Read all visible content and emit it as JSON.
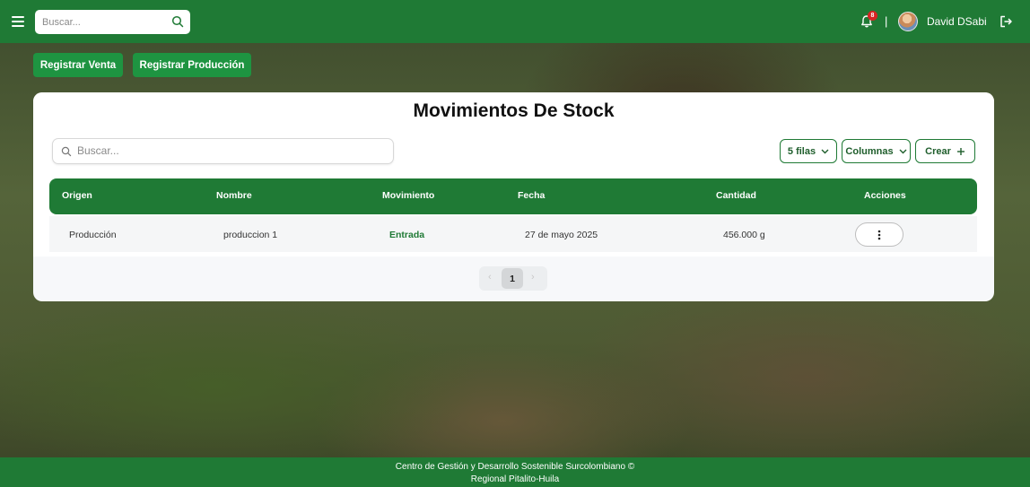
{
  "header": {
    "search_placeholder": "Buscar...",
    "notification_count": "8",
    "separator": "|",
    "user_name": "David DSabi"
  },
  "actions": {
    "register_sale": "Registrar Venta",
    "register_production": "Registrar Producción"
  },
  "card": {
    "title": "Movimientos De Stock",
    "search_placeholder": "Buscar...",
    "rows_label": "5 filas",
    "columns_label": "Columnas",
    "create_label": "Crear"
  },
  "table": {
    "columns": [
      "Origen",
      "Nombre",
      "Movimiento",
      "Fecha",
      "Cantidad",
      "Acciones"
    ],
    "rows": [
      {
        "origen": "Producción",
        "nombre": "produccion 1",
        "movimiento": "Entrada",
        "fecha": "27 de mayo 2025",
        "cantidad": "456.000 g"
      }
    ]
  },
  "pagination": {
    "prev": "‹",
    "current": "1",
    "next": "›"
  },
  "footer": {
    "line1": "Centro de Gestión y Desarrollo Sostenible Surcolombiano ©",
    "line2": "Regional Pitalito-Huila"
  },
  "colors": {
    "primary": "#1f7a35",
    "button_green": "#1e9441",
    "badge_red": "#d62424"
  }
}
